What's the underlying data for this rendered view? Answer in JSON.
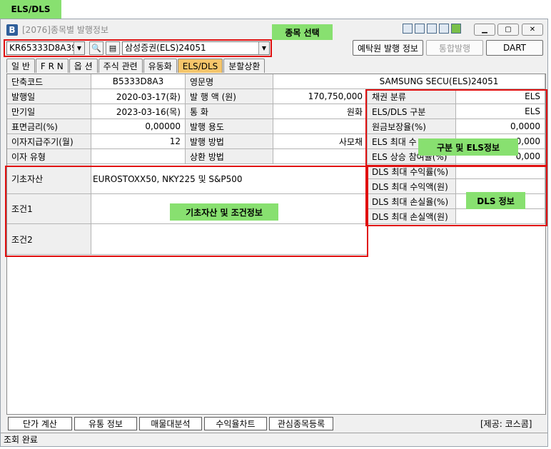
{
  "header_tag": "ELS/DLS",
  "window": {
    "app_icon": "B",
    "title": "[2076]종목별 발행정보"
  },
  "callouts": {
    "stock_select": "종목 선택",
    "els_info": "구분 및 ELS정보",
    "dls_info": "DLS 정보",
    "underlying_info": "기초자산 및 조건정보"
  },
  "search": {
    "code": "KR65333D8A39",
    "name": "삼성증권(ELS)24051"
  },
  "top_buttons": {
    "ksd": "예탁원 발행 정보",
    "integrated": "통합발행",
    "dart": "DART"
  },
  "tabs": [
    "일  반",
    "F R N",
    "옵  션",
    "주식 관련",
    "유동화",
    "ELS/DLS",
    "분할상환"
  ],
  "active_tab": "ELS/DLS",
  "info": {
    "short_code_label": "단축코드",
    "short_code": "B5333D8A3",
    "eng_name_label": "영문명",
    "eng_name": "SAMSUNG SECU(ELS)24051",
    "issue_date_label": "발행일",
    "issue_date": "2020-03-17(화)",
    "issue_amount_label": "발 행 액 (원)",
    "issue_amount": "170,750,000",
    "maturity_label": "만기일",
    "maturity": "2023-03-16(목)",
    "currency_label": "통  화",
    "currency": "원화",
    "coupon_label": "표면금리(%)",
    "coupon": "0,00000",
    "purpose_label": "발행 용도",
    "purpose": "",
    "interest_period_label": "이자지급주기(월)",
    "interest_period": "12",
    "method_label": "발행 방법",
    "method": "사모채",
    "interest_type_label": "이자 유형",
    "interest_type": "",
    "redemption_label": "상환 방법",
    "redemption": ""
  },
  "els": {
    "bond_class_label": "채권 분류",
    "bond_class": "ELS",
    "type_label": "ELS/DLS 구분",
    "type": "ELS",
    "principal_label": "원금보장율(%)",
    "principal": "0,0000",
    "max_label": "ELS 최대 수",
    "max": "0,000",
    "participation_label": "ELS 상승 참여율(%)",
    "participation": "0,000"
  },
  "underlying": {
    "asset_label": "기초자산",
    "asset": "EUROSTOXX50, NKY225 및 S&P500",
    "cond1_label": "조건1",
    "cond1": "",
    "cond2_label": "조건2",
    "cond2": ""
  },
  "dls": {
    "max_return_rate": "DLS 최대 수익률(%)",
    "max_return_amt": "DLS 최대 수익액(원)",
    "max_loss_rate": "DLS 최대 손실율(%)",
    "max_loss_amt": "DLS 최대 손실액(원)"
  },
  "bottom_buttons": [
    "단가 계산",
    "유통 정보",
    "매물대분석",
    "수익율차트",
    "관심종목등록"
  ],
  "provider": "[제공: 코스콤]",
  "status": "조회 완료"
}
